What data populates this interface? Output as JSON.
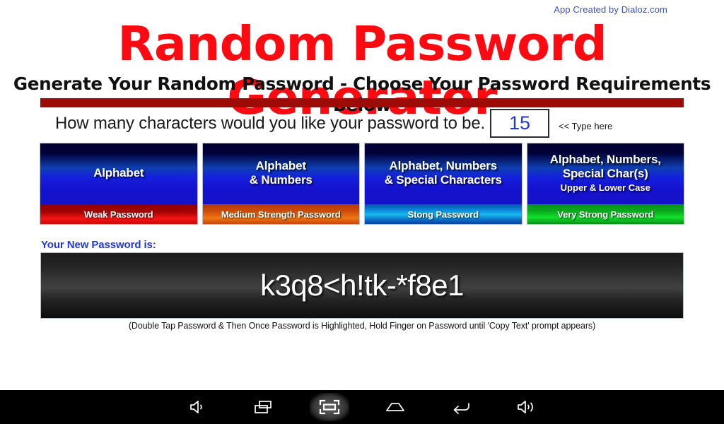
{
  "credit": "App Created by Dialoz.com",
  "header": {
    "title": "Random Password Generator",
    "subtitle": "Generate Your Random Password - Choose Your Password Requirements Below"
  },
  "length": {
    "question": "How many characters would you like your password to be.",
    "value": "15",
    "placeholder": "15",
    "hint": "<< Type here"
  },
  "options": [
    {
      "title": "Alphabet",
      "subtitle": "",
      "strength": "Weak Password",
      "strength_color": "#f41515"
    },
    {
      "title": "Alphabet\n& Numbers",
      "subtitle": "",
      "strength": "Medium Strength Password",
      "strength_color": "#f07714"
    },
    {
      "title": "Alphabet, Numbers\n& Special Characters",
      "subtitle": "",
      "strength": "Stong Password",
      "strength_color": "#18b8f0"
    },
    {
      "title": "Alphabet, Numbers,\nSpecial Char(s)",
      "subtitle": "Upper & Lower Case",
      "strength": "Very Strong Password",
      "strength_color": "#12e02a"
    }
  ],
  "result": {
    "label": "Your New Password is:",
    "password": "k3q8<h!tk-*f8e1",
    "hint": "(Double Tap Password & Then Once Password is Highlighted, Hold Finger on Password until 'Copy Text' prompt appears)"
  },
  "navbar": {
    "buttons": [
      {
        "name": "volume-down-icon",
        "label": "Volume Down",
        "active": false
      },
      {
        "name": "recent-apps-icon",
        "label": "Recent Apps",
        "active": false
      },
      {
        "name": "screenshot-icon",
        "label": "Screenshot",
        "active": true
      },
      {
        "name": "home-icon",
        "label": "Home",
        "active": false
      },
      {
        "name": "back-icon",
        "label": "Back",
        "active": false
      },
      {
        "name": "volume-up-icon",
        "label": "Volume Up",
        "active": false
      }
    ]
  },
  "colors": {
    "title_red": "#fb0a11",
    "rule_red": "#9d0b06",
    "accent_blue": "#2138d8",
    "button_blue": "#1512cf"
  }
}
